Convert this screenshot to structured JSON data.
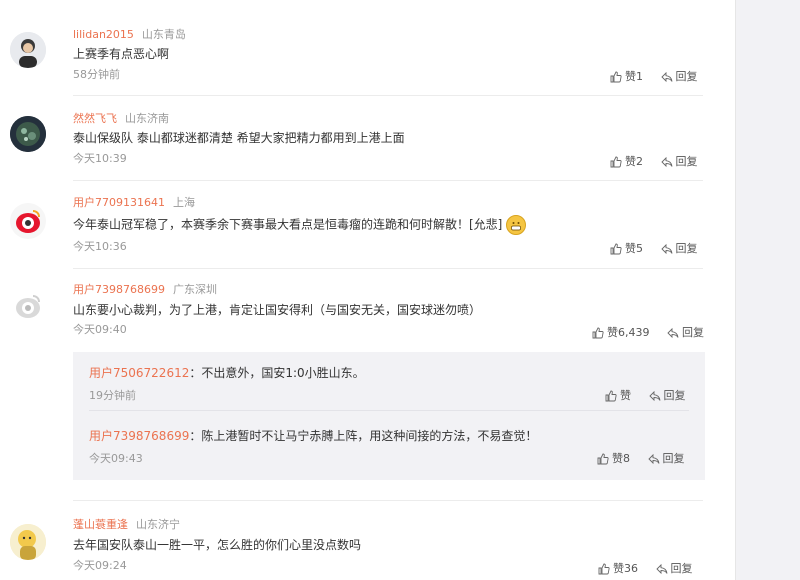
{
  "comments": [
    {
      "user": "lilidan2015",
      "location": "山东青岛",
      "text": "上赛季有点恶心啊",
      "time": "58分钟前",
      "likes": "赞1",
      "reply": "回复"
    },
    {
      "user": "然然飞飞",
      "location": "山东济南",
      "text": "泰山保级队  泰山都球迷都清楚  希望大家把精力都用到上港上面",
      "time": "今天10:39",
      "likes": "赞2",
      "reply": "回复"
    },
    {
      "user": "用户7709131641",
      "location": "上海",
      "text": "今年泰山冠军稳了，本赛季余下赛事最大看点是恒毒瘤的连跪和何时解散！[允悲]",
      "time": "今天10:36",
      "likes": "赞5",
      "reply": "回复"
    },
    {
      "user": "用户7398768699",
      "location": "广东深圳",
      "text": "山东要小心裁判，为了上港，肯定让国安得利（与国安无关，国安球迷勿喷）",
      "time": "今天09:40",
      "likes": "赞6,439",
      "reply": "回复"
    },
    {
      "user": "蓬山蓑重逢",
      "location": "山东济宁",
      "text": "去年国安队泰山一胜一平，怎么胜的你们心里没点数吗",
      "time": "今天09:24",
      "likes": "赞36",
      "reply": "回复"
    }
  ],
  "replies": [
    {
      "user": "用户7506722612",
      "text": "：不出意外，国安1:0小胜山东。",
      "time": "19分钟前",
      "likes": "赞",
      "reply": "回复"
    },
    {
      "user": "用户7398768699",
      "text": "：陈上港暂时不让马宁赤膊上阵，用这种间接的方法，不易查觉！",
      "time": "今天09:43",
      "likes": "赞8",
      "reply": "回复"
    }
  ]
}
